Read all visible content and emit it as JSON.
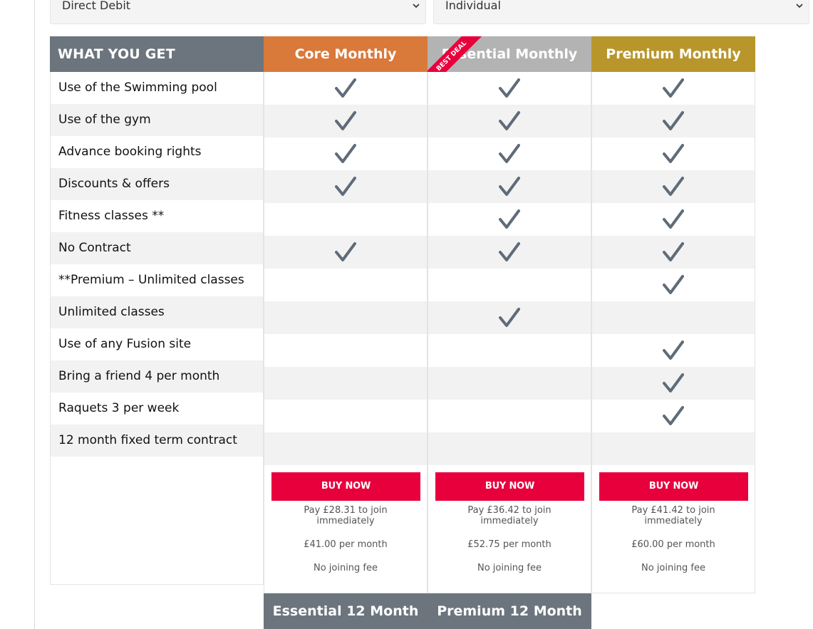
{
  "selects": {
    "payment_method": "Direct Debit",
    "membership_type": "Individual"
  },
  "table": {
    "feature_header": "WHAT YOU GET",
    "features": [
      "Use of the Swimming pool",
      "Use of the gym",
      "Advance booking rights",
      "Discounts & offers",
      "Fitness classes **",
      "No Contract",
      "**Premium – Unlimited classes",
      "Unlimited classes",
      "Use of any Fusion site",
      "Bring a friend 4 per month",
      "Raquets 3 per week",
      "12 month fixed term contract"
    ],
    "plans": [
      {
        "name": "Core Monthly",
        "header_color": "#d9793a",
        "checks": [
          true,
          true,
          true,
          true,
          false,
          true,
          false,
          false,
          false,
          false,
          false,
          false
        ],
        "buy_label": "BUY NOW",
        "pay_text": "Pay £28.31 to join immediately",
        "per_month": "£41.00 per month",
        "joining_fee": "No joining fee"
      },
      {
        "name": "Essential Monthly",
        "header_color": "#b3b3b3",
        "ribbon": "BEST DEAL",
        "checks": [
          true,
          true,
          true,
          true,
          true,
          true,
          false,
          true,
          false,
          false,
          false,
          false
        ],
        "buy_label": "BUY NOW",
        "pay_text": "Pay £36.42 to join immediately",
        "per_month": "£52.75 per month",
        "joining_fee": "No joining fee"
      },
      {
        "name": "Premium Monthly",
        "header_color": "#b8962b",
        "checks": [
          true,
          true,
          true,
          true,
          true,
          true,
          true,
          false,
          true,
          true,
          true,
          false
        ],
        "buy_label": "BUY NOW",
        "pay_text": "Pay £41.42 to join immediately",
        "per_month": "£60.00 per month",
        "joining_fee": "No joining fee"
      }
    ]
  },
  "bottom_headers": [
    "Essential 12 Month",
    "Premium 12 Month"
  ],
  "colors": {
    "buy_button": "#e8003d",
    "check": "#5f6b78",
    "feature_header": "#6c757d"
  },
  "icons": {
    "check": "check-icon",
    "select_arrow": "chevron-down-icon"
  }
}
